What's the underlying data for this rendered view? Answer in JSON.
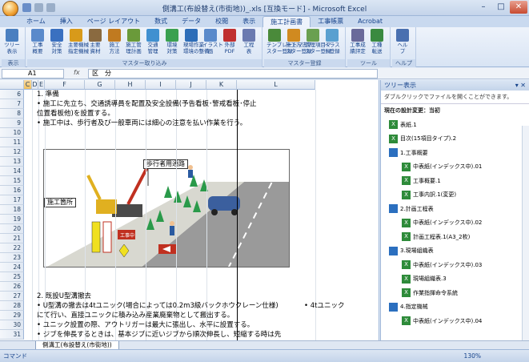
{
  "window": {
    "title": "側溝工(布設替え(市街地))_.xls  [互換モード] - Microsoft Excel"
  },
  "tabs": [
    "ホーム",
    "挿入",
    "ページ レイアウト",
    "数式",
    "データ",
    "校閲",
    "表示",
    "施工計画書",
    "工事帳票",
    "Acrobat"
  ],
  "active_tab": "施工計画書",
  "ribbon": {
    "groups": [
      {
        "label": "表示",
        "buttons": [
          {
            "label": "ツリー\n表示",
            "icon": "tree-view-icon",
            "color": "#4a7fc0"
          }
        ]
      },
      {
        "label": "マスター取り込み",
        "buttons": [
          {
            "label": "工事\n概要",
            "icon": "document-icon",
            "color": "#5a8acb"
          },
          {
            "label": "安全\n対策",
            "icon": "safety-cone-icon",
            "color": "#3a70c0"
          },
          {
            "label": "主要機械\n指定機械",
            "icon": "excavator-icon",
            "color": "#d89a1a"
          },
          {
            "label": "主要\n資材",
            "icon": "material-icon",
            "color": "#8a6a40"
          },
          {
            "label": "施工\n方法",
            "icon": "construction-icon",
            "color": "#c07a20"
          },
          {
            "label": "施工管\n理計画",
            "icon": "gear-icon",
            "color": "#6a9a3a"
          },
          {
            "label": "交通\n管理",
            "icon": "traffic-icon",
            "color": "#4090d0"
          },
          {
            "label": "環境\n対策",
            "icon": "recycle-icon",
            "color": "#3aa050"
          },
          {
            "label": "現場作業\n環境の整備",
            "icon": "worker-icon",
            "color": "#2d6db8"
          },
          {
            "label": "イラスト\n画",
            "icon": "picture-icon",
            "color": "#5a8acb"
          },
          {
            "label": "外部\nPDF",
            "icon": "pdf-icon",
            "color": "#c03030"
          },
          {
            "label": "工程\n表",
            "icon": "schedule-icon",
            "color": "#6a7ab0"
          }
        ]
      },
      {
        "label": "マスター登録",
        "buttons": [
          {
            "label": "テンプレートマ\nスター登録",
            "icon": "template-icon",
            "color": "#4a8a3a"
          },
          {
            "label": "施工方法マ\nスター登録",
            "icon": "method-icon",
            "color": "#d08a20"
          },
          {
            "label": "管理項目マ\nスター登録",
            "icon": "manage-icon",
            "color": "#6aa050"
          },
          {
            "label": "イラス\nト登録",
            "icon": "illust-icon",
            "color": "#5aa0d0"
          }
        ]
      },
      {
        "label": "ツール",
        "buttons": [
          {
            "label": "工事成\n績評定",
            "icon": "evaluation-icon",
            "color": "#6a6a9a"
          },
          {
            "label": "工種\n転送",
            "icon": "transfer-icon",
            "color": "#3a8a40"
          }
        ]
      },
      {
        "label": "ヘルプ",
        "buttons": [
          {
            "label": "ヘル\nプ",
            "icon": "help-icon",
            "color": "#4a70b0"
          }
        ]
      }
    ]
  },
  "formula_bar": {
    "cell_ref": "A1",
    "fx": "fx",
    "value": "区　分"
  },
  "columns": [
    "C",
    "D",
    "E",
    "F",
    "G",
    "H",
    "I",
    "J",
    "K",
    "L"
  ],
  "rows": [
    "6",
    "7",
    "8",
    "9",
    "10",
    "11",
    "12",
    "13",
    "14",
    "15",
    "16",
    "17",
    "18",
    "19",
    "20",
    "21",
    "22",
    "23",
    "24",
    "25",
    "26",
    "27",
    "28",
    "29",
    "30",
    "31"
  ],
  "cells": {
    "r6": "1. 準備",
    "r7": "• 施工に先立ち、交通誘導員を配置及安全設備(予告看板･警戒看板･停止",
    "r8": "   位置看板他)を設置する。",
    "r9": "• 施工中は、歩行者及び一般車両には細心の注意を払い作業を行う。",
    "r27": "2. 既設U型溝撤去",
    "r28": "• U型溝の撤去は4tユニック(場合によっては0.2m3級バックホウクレーン仕様)",
    "r28_l": "• 4tユニック",
    "r29": "   にて行い、直接ユニックに積み込み産業廃棄物として搬出する。",
    "r30": "• ユニック設置の際、アウトリガーは最大に張出し、水平に設置する。",
    "r31": "• ジブを伸長するときは、基本ジブに近いジブから順次伸長し、短縮する時は先"
  },
  "diagram": {
    "label_walkway": "歩行者用通路",
    "label_site": "施工箇所",
    "sign_text": "工事中"
  },
  "sheet_tab": "側溝工(布設替え(市街地))",
  "status": {
    "mode": "コマンド",
    "zoom": "130%"
  },
  "tree_panel": {
    "title": "ツリー表示",
    "note": "ダブルクリックでファイルを開くことができます。",
    "current": "現在の設計変更：当初",
    "items": [
      {
        "label": "表紙.1",
        "type": "xls",
        "level": 0
      },
      {
        "label": "目次(15項目タイプ).2",
        "type": "xls",
        "level": 0
      },
      {
        "label": "1.工事概要",
        "type": "folder",
        "level": 0
      },
      {
        "label": "中表紙(インデックス中).01",
        "type": "xls",
        "level": 1
      },
      {
        "label": "工事概要.1",
        "type": "xls",
        "level": 1
      },
      {
        "label": "工事内訳.1(変更)",
        "type": "xls",
        "level": 1
      },
      {
        "label": "2.計画工程表",
        "type": "folder",
        "level": 0
      },
      {
        "label": "中表紙(インデックス中).02",
        "type": "xls",
        "level": 1
      },
      {
        "label": "計画工程表.1(A3_2枚)",
        "type": "xls",
        "level": 1
      },
      {
        "label": "3.現場組織表",
        "type": "folder",
        "level": 0
      },
      {
        "label": "中表紙(インデックス中).03",
        "type": "xls",
        "level": 1
      },
      {
        "label": "現場組織表.3",
        "type": "xls",
        "level": 1
      },
      {
        "label": "作業指揮命令系統",
        "type": "xls",
        "level": 1
      },
      {
        "label": "4.指定機械",
        "type": "folder",
        "level": 0
      },
      {
        "label": "中表紙(インデックス中).04",
        "type": "xls",
        "level": 1
      }
    ]
  }
}
